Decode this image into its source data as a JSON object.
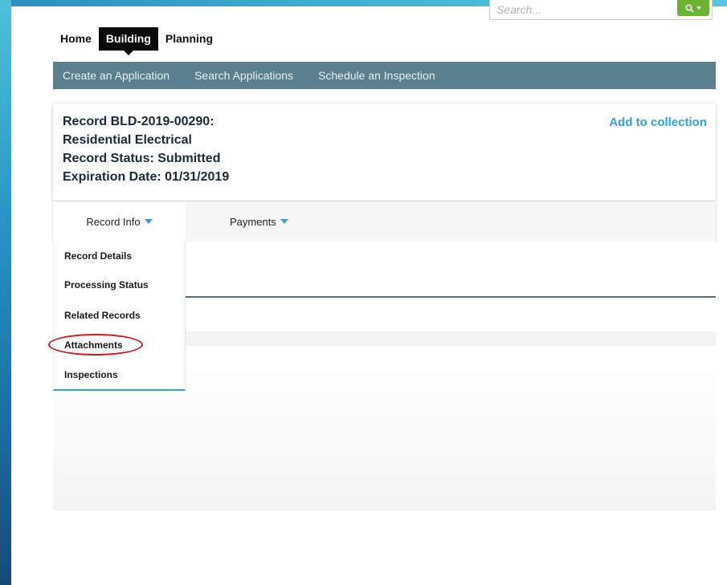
{
  "search": {
    "placeholder": "Search..."
  },
  "topnav": {
    "items": [
      {
        "label": "Home",
        "active": false
      },
      {
        "label": "Building",
        "active": true
      },
      {
        "label": "Planning",
        "active": false
      }
    ]
  },
  "subnav": {
    "items": [
      {
        "label": "Create an Application"
      },
      {
        "label": "Search Applications"
      },
      {
        "label": "Schedule an Inspection"
      }
    ]
  },
  "record": {
    "id_line": "Record BLD-2019-00290:",
    "type_line": "Residential Electrical",
    "status_line": "Record Status: Submitted",
    "expiration_line": "Expiration Date: 01/31/2019",
    "add_to_collection": "Add to collection"
  },
  "tabs": {
    "record_info": "Record Info",
    "payments": "Payments"
  },
  "dropdown": {
    "items": [
      {
        "label": "Record Details"
      },
      {
        "label": "Processing Status"
      },
      {
        "label": "Related Records"
      },
      {
        "label": "Attachments",
        "highlighted": true
      },
      {
        "label": "Inspections"
      }
    ]
  },
  "colors": {
    "accent": "#2ea3dc",
    "subnav_bg": "#5a7f8f",
    "search_button": "#6ab42f",
    "highlight": "#d11a1a"
  }
}
